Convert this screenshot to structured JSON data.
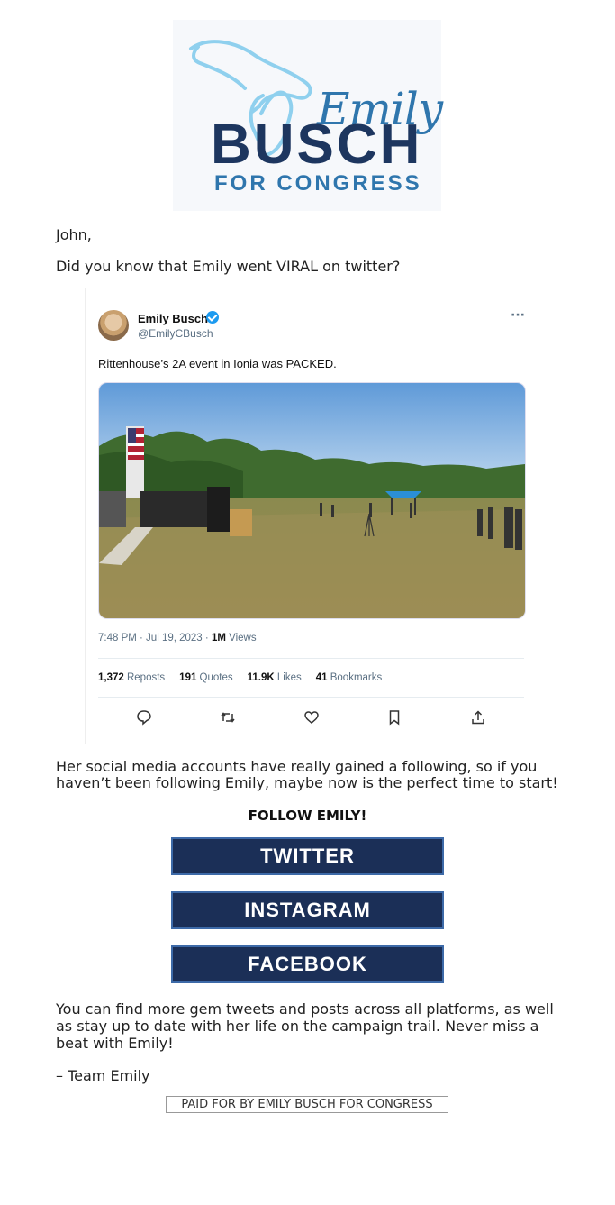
{
  "logo": {
    "first_name": "Emily",
    "last_name": "BUSCH",
    "tagline": "FOR CONGRESS",
    "colors": {
      "navy": "#1d365f",
      "blue": "#2f76ad",
      "map_outline": "#8fd0ee"
    }
  },
  "email": {
    "greeting": "John,",
    "intro": "Did you know that Emily went VIRAL on twitter?",
    "body_1": "Her social media accounts have really gained a following, so if you haven’t been following Emily, maybe now is the perfect time to start!",
    "follow_heading": "FOLLOW EMILY!",
    "buttons": {
      "twitter": "TWITTER",
      "instagram": "INSTAGRAM",
      "facebook": "FACEBOOK"
    },
    "body_2": "You can find more gem tweets and posts across all platforms, as well as stay up to date with her life on the campaign trail. Never miss a beat with Emily!",
    "signoff": "– Team Emily",
    "disclaimer": "PAID FOR BY EMILY BUSCH FOR CONGRESS"
  },
  "tweet": {
    "name": "Emily Busch",
    "handle": "@EmilyCBusch",
    "more": "···",
    "text": "Rittenhouse’s 2A event in Ionia was PACKED.",
    "time_date": "7:48 PM · Jul 19, 2023 · ",
    "views_count": "1M",
    "views_label": " Views",
    "stats": {
      "reposts_count": "1,372",
      "reposts_label": " Reposts",
      "quotes_count": "191",
      "quotes_label": " Quotes",
      "likes_count": "11.9K",
      "likes_label": " Likes",
      "bookmarks_count": "41",
      "bookmarks_label": " Bookmarks"
    },
    "action_icons": [
      "reply-icon",
      "repost-icon",
      "like-icon",
      "bookmark-icon",
      "share-icon"
    ]
  },
  "colors": {
    "button_bg": "#1b2f57",
    "verified": "#1d9bf0"
  }
}
